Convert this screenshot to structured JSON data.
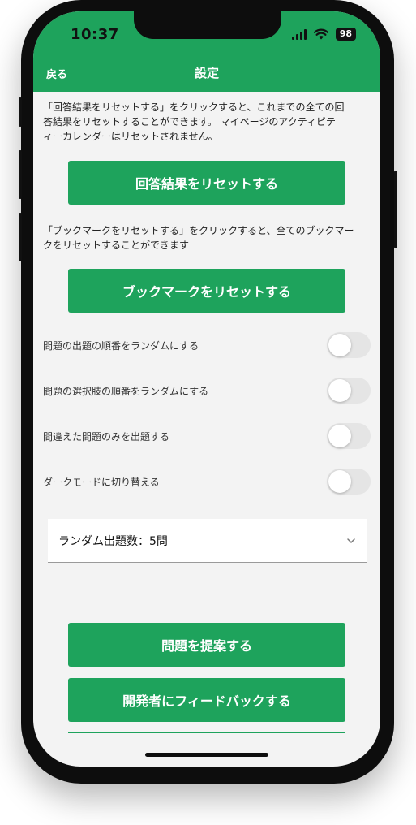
{
  "status_bar": {
    "time": "10:37",
    "battery": "98"
  },
  "nav": {
    "back_label": "戻る",
    "title": "設定"
  },
  "reset_answers": {
    "description_line1": "「回答結果をリセットする」をクリックすると、これまでの全ての回",
    "description_line2": "答結果をリセットすることができます。 マイページのアクティビテ",
    "description_line3": "ィーカレンダーはリセットされません。",
    "button_label": "回答結果をリセットする"
  },
  "reset_bookmarks": {
    "description_line1": "「ブックマークをリセットする」をクリックすると、全てのブックマー",
    "description_line2": "クをリセットすることができます",
    "button_label": "ブックマークをリセットする"
  },
  "toggles": [
    {
      "label": "問題の出題の順番をランダムにする",
      "on": false
    },
    {
      "label": "問題の選択肢の順番をランダムにする",
      "on": false
    },
    {
      "label": "間違えた問題のみを出題する",
      "on": false
    },
    {
      "label": "ダークモードに切り替える",
      "on": false
    }
  ],
  "random_count_select": {
    "value": "ランダム出題数：5問"
  },
  "actions": {
    "suggest_label": "問題を提案する",
    "feedback_label": "開発者にフィードバックする"
  },
  "colors": {
    "accent": "#1ea35c",
    "background": "#f3f3f3"
  }
}
